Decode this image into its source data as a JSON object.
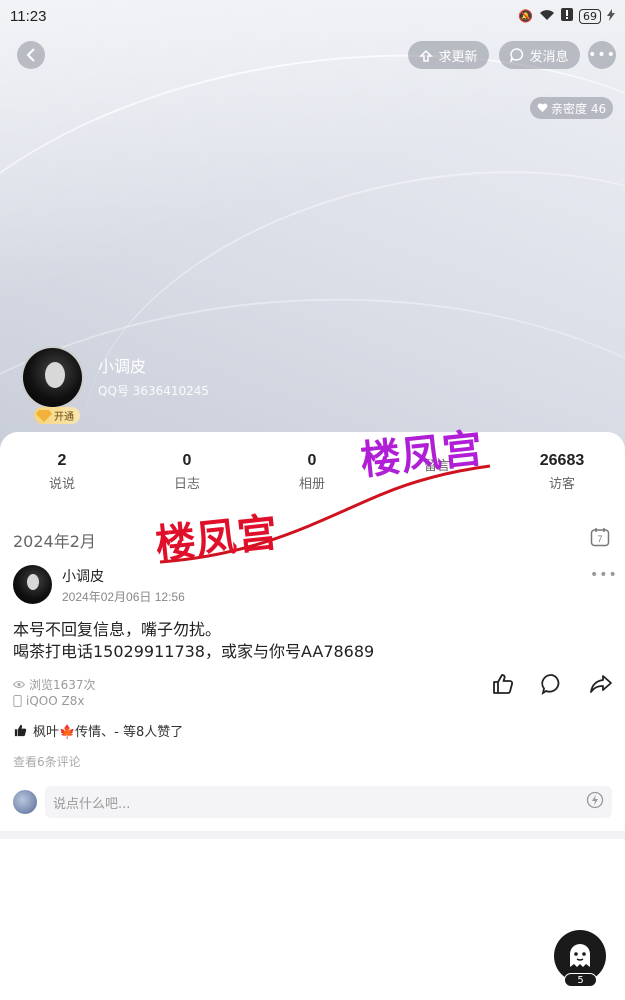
{
  "status_bar": {
    "time": "11:23",
    "battery": "69"
  },
  "header": {
    "request_update_label": "求更新",
    "send_message_label": "发消息",
    "intimacy_label": "亲密度 46"
  },
  "profile": {
    "name": "小调皮",
    "qq": "QQ号 3636410245",
    "vip_label": "开通"
  },
  "stats": [
    {
      "value": "2",
      "label": "说说"
    },
    {
      "value": "0",
      "label": "日志"
    },
    {
      "value": "0",
      "label": "相册"
    },
    {
      "value": "",
      "label": "留言"
    },
    {
      "value": "26683",
      "label": "访客"
    }
  ],
  "watermark": {
    "left_text": "楼凤宫",
    "right_text": "楼凤宫",
    "left_color": "#e0102a",
    "right_color": "#b01fd6"
  },
  "feed": {
    "month": "2024年2月",
    "calendar_day": "7",
    "post": {
      "author": "小调皮",
      "time": "2024年02月06日 12:56",
      "text_line1": "本号不回复信息，嘴子勿扰。",
      "text_line2": "喝茶打电话15029911738，或家与你号AA78689",
      "views": "浏览1637次",
      "device": "iQOO Z8x",
      "likes": "枫叶🍁传情、- 等8人赞了",
      "comments_link": "查看6条评论"
    },
    "comment_placeholder": "说点什么吧..."
  },
  "fab": {
    "badge": "5"
  }
}
